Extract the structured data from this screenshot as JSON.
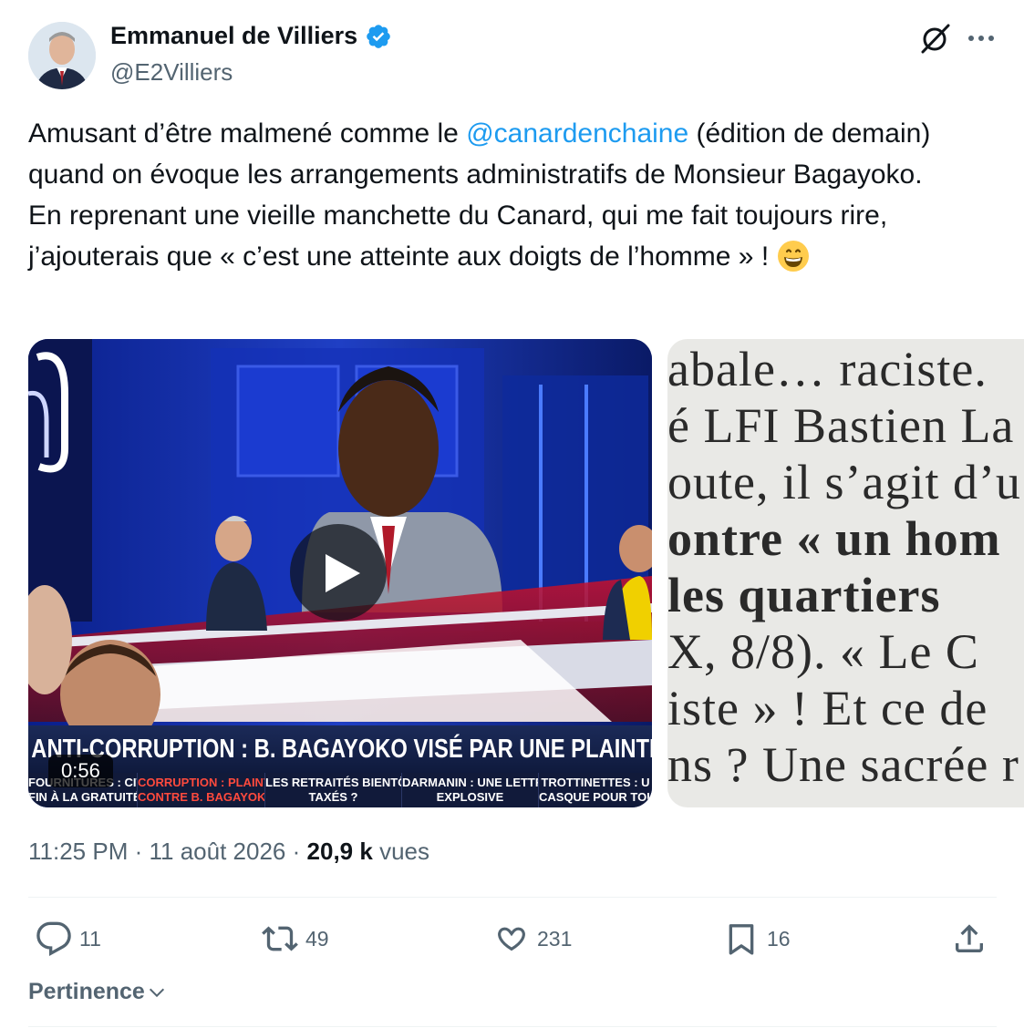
{
  "author": {
    "name": "Emmanuel de Villiers",
    "handle": "@E2Villiers",
    "verified": true
  },
  "tweet": {
    "line1_before": "Amusant d’être malmené comme le ",
    "mention": "@canardenchaine",
    "line1_after": " (édition de demain) quand on évoque les arrangements administratifs de Monsieur Bagayoko.",
    "line2": "En reprenant une vieille manchette du Canard, qui me fait toujours rire, j’ajouterais que « c’est une atteinte aux doigts de l’homme » !",
    "emoji_icon": "grinning-face-emoji"
  },
  "video": {
    "duration": "0:56",
    "headline": "ANTI-CORRUPTION : B. BAGAYOKO VISÉ PAR UNE PLAINTE",
    "ticker": [
      {
        "line1": "FOURNITURES : CITO",
        "line2": "FIN À LA GRATUITÉ",
        "red": false
      },
      {
        "line1": "CORRUPTION : PLAINTE",
        "line2": "CONTRE B. BAGAYOKO",
        "red": true
      },
      {
        "line1": "LES RETRAITÉS BIENTÔT",
        "line2": "TAXÉS ?",
        "red": false
      },
      {
        "line1": "DARMANIN : UNE LETTRE",
        "line2": "EXPLOSIVE",
        "red": false
      },
      {
        "line1": "TROTTINETTES : U",
        "line2": "CASQUE POUR TOU",
        "red": false
      }
    ]
  },
  "article_lines": [
    "abale… raciste.",
    "é LFI Bastien La",
    "oute, il s’agit d’u",
    "ontre « un hom",
    "les  quartiers",
    "X, 8/8). « Le C",
    "iste » ! Et ce de",
    "ns ? Une sacrée r"
  ],
  "meta": {
    "time": "11:25 PM",
    "date": "11 août 2026",
    "separator": "·",
    "views_count": "20,9 k",
    "views_label": "vues"
  },
  "actions": {
    "replies": "11",
    "reposts": "49",
    "likes": "231",
    "bookmarks": "16"
  },
  "sort": {
    "label": "Pertinence"
  },
  "colors": {
    "accent": "#1d9bf0",
    "secondary_text": "#536471",
    "primary_text": "#0f1419"
  }
}
